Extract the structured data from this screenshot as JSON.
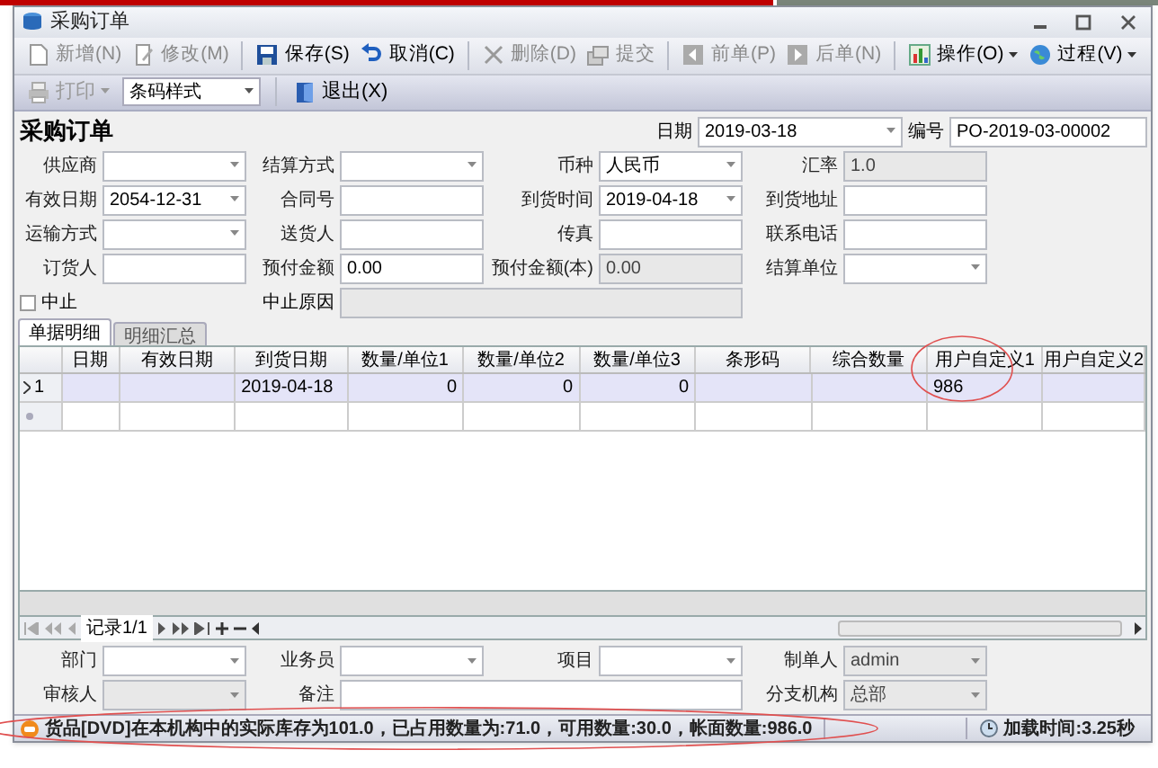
{
  "window": {
    "title": "采购订单"
  },
  "toolbar": [
    {
      "label": "新增(N)",
      "disabled": true,
      "dropdown": false
    },
    {
      "label": "修改(M)",
      "disabled": true,
      "dropdown": false
    },
    {
      "label": "保存(S)",
      "disabled": false,
      "dropdown": false
    },
    {
      "label": "取消(C)",
      "disabled": false,
      "dropdown": false
    },
    {
      "label": "删除(D)",
      "disabled": true,
      "dropdown": false
    },
    {
      "label": "提交",
      "disabled": true,
      "dropdown": false
    },
    {
      "label": "前单(P)",
      "disabled": true,
      "dropdown": false
    },
    {
      "label": "后单(N)",
      "disabled": true,
      "dropdown": false
    },
    {
      "label": "操作(O)",
      "disabled": false,
      "dropdown": true
    },
    {
      "label": "过程(V)",
      "disabled": false,
      "dropdown": true
    }
  ],
  "toolbar2": {
    "print": {
      "label": "打印",
      "disabled": true
    },
    "style_select": {
      "value": "条码样式"
    },
    "exit": {
      "label": "退出(X)"
    }
  },
  "form": {
    "title": "采购订单",
    "date": {
      "label": "日期",
      "value": "2019-03-18"
    },
    "number": {
      "label": "编号",
      "value": "PO-2019-03-00002"
    },
    "rows": [
      [
        {
          "label": "供应商",
          "kind": "dropdown"
        },
        {
          "label": "结算方式",
          "kind": "dropdown"
        },
        {
          "label": "币种",
          "kind": "dropdown",
          "value": "人民币"
        },
        {
          "label": "汇率",
          "kind": "text",
          "value": "1.0",
          "disabled": true
        }
      ],
      [
        {
          "label": "有效日期",
          "kind": "dropdown",
          "value": "2054-12-31"
        },
        {
          "label": "合同号",
          "kind": "text"
        },
        {
          "label": "到货时间",
          "kind": "dropdown",
          "value": "2019-04-18"
        },
        {
          "label": "到货地址",
          "kind": "ellipsis"
        }
      ],
      [
        {
          "label": "运输方式",
          "kind": "dropdown"
        },
        {
          "label": "送货人",
          "kind": "text"
        },
        {
          "label": "传真",
          "kind": "text"
        },
        {
          "label": "联系电话",
          "kind": "text"
        }
      ],
      [
        {
          "label": "订货人",
          "kind": "text"
        },
        {
          "label": "预付金额",
          "kind": "text",
          "value": "0.00"
        },
        {
          "label": "预付金额(本)",
          "kind": "text",
          "value": "0.00",
          "disabled": true
        },
        {
          "label": "结算单位",
          "kind": "dropdown"
        }
      ]
    ],
    "stop": {
      "label": "中止",
      "checked": false
    },
    "stop_reason": {
      "label": "中止原因",
      "disabled": true
    }
  },
  "tabs": [
    {
      "label": "单据明细",
      "selected": true
    },
    {
      "label": "明细汇总",
      "selected": false
    }
  ],
  "grid": {
    "columns": [
      {
        "title": "日期"
      },
      {
        "title": "有效日期"
      },
      {
        "title": "到货日期"
      },
      {
        "title": "数量/单位1",
        "kind": "number"
      },
      {
        "title": "数量/单位2",
        "kind": "number"
      },
      {
        "title": "数量/单位3",
        "kind": "number"
      },
      {
        "title": "条形码"
      },
      {
        "title": "综合数量"
      },
      {
        "title": "用户自定义1"
      },
      {
        "title": "用户自定义2"
      }
    ],
    "rows": [
      {
        "number": "1",
        "current": true,
        "cells": [
          "",
          "",
          "2019-04-18",
          "0",
          "0",
          "0",
          "",
          "",
          "986",
          ""
        ]
      }
    ]
  },
  "navigator": {
    "record": "记录1/1"
  },
  "bottom_form": {
    "fields": [
      {
        "label": "部门",
        "kind": "dropdown"
      },
      {
        "label": "业务员",
        "kind": "dropdown"
      },
      {
        "label": "项目",
        "kind": "dropdown"
      },
      {
        "label": "制单人",
        "kind": "dropdown",
        "value": "admin",
        "disabled": true
      },
      {
        "label": "审核人",
        "kind": "dropdown",
        "disabled": true
      },
      {
        "label": "备注",
        "kind": "ellipsis"
      },
      {
        "label": "分支机构",
        "kind": "dropdown",
        "value": "总部",
        "disabled": true
      }
    ]
  },
  "status_bar": {
    "message": "货品[DVD]在本机构中的实际库存为101.0，已占用数量为:71.0，可用数量:30.0，帐面数量:986.0",
    "load_time": "加载时间:3.25秒"
  }
}
